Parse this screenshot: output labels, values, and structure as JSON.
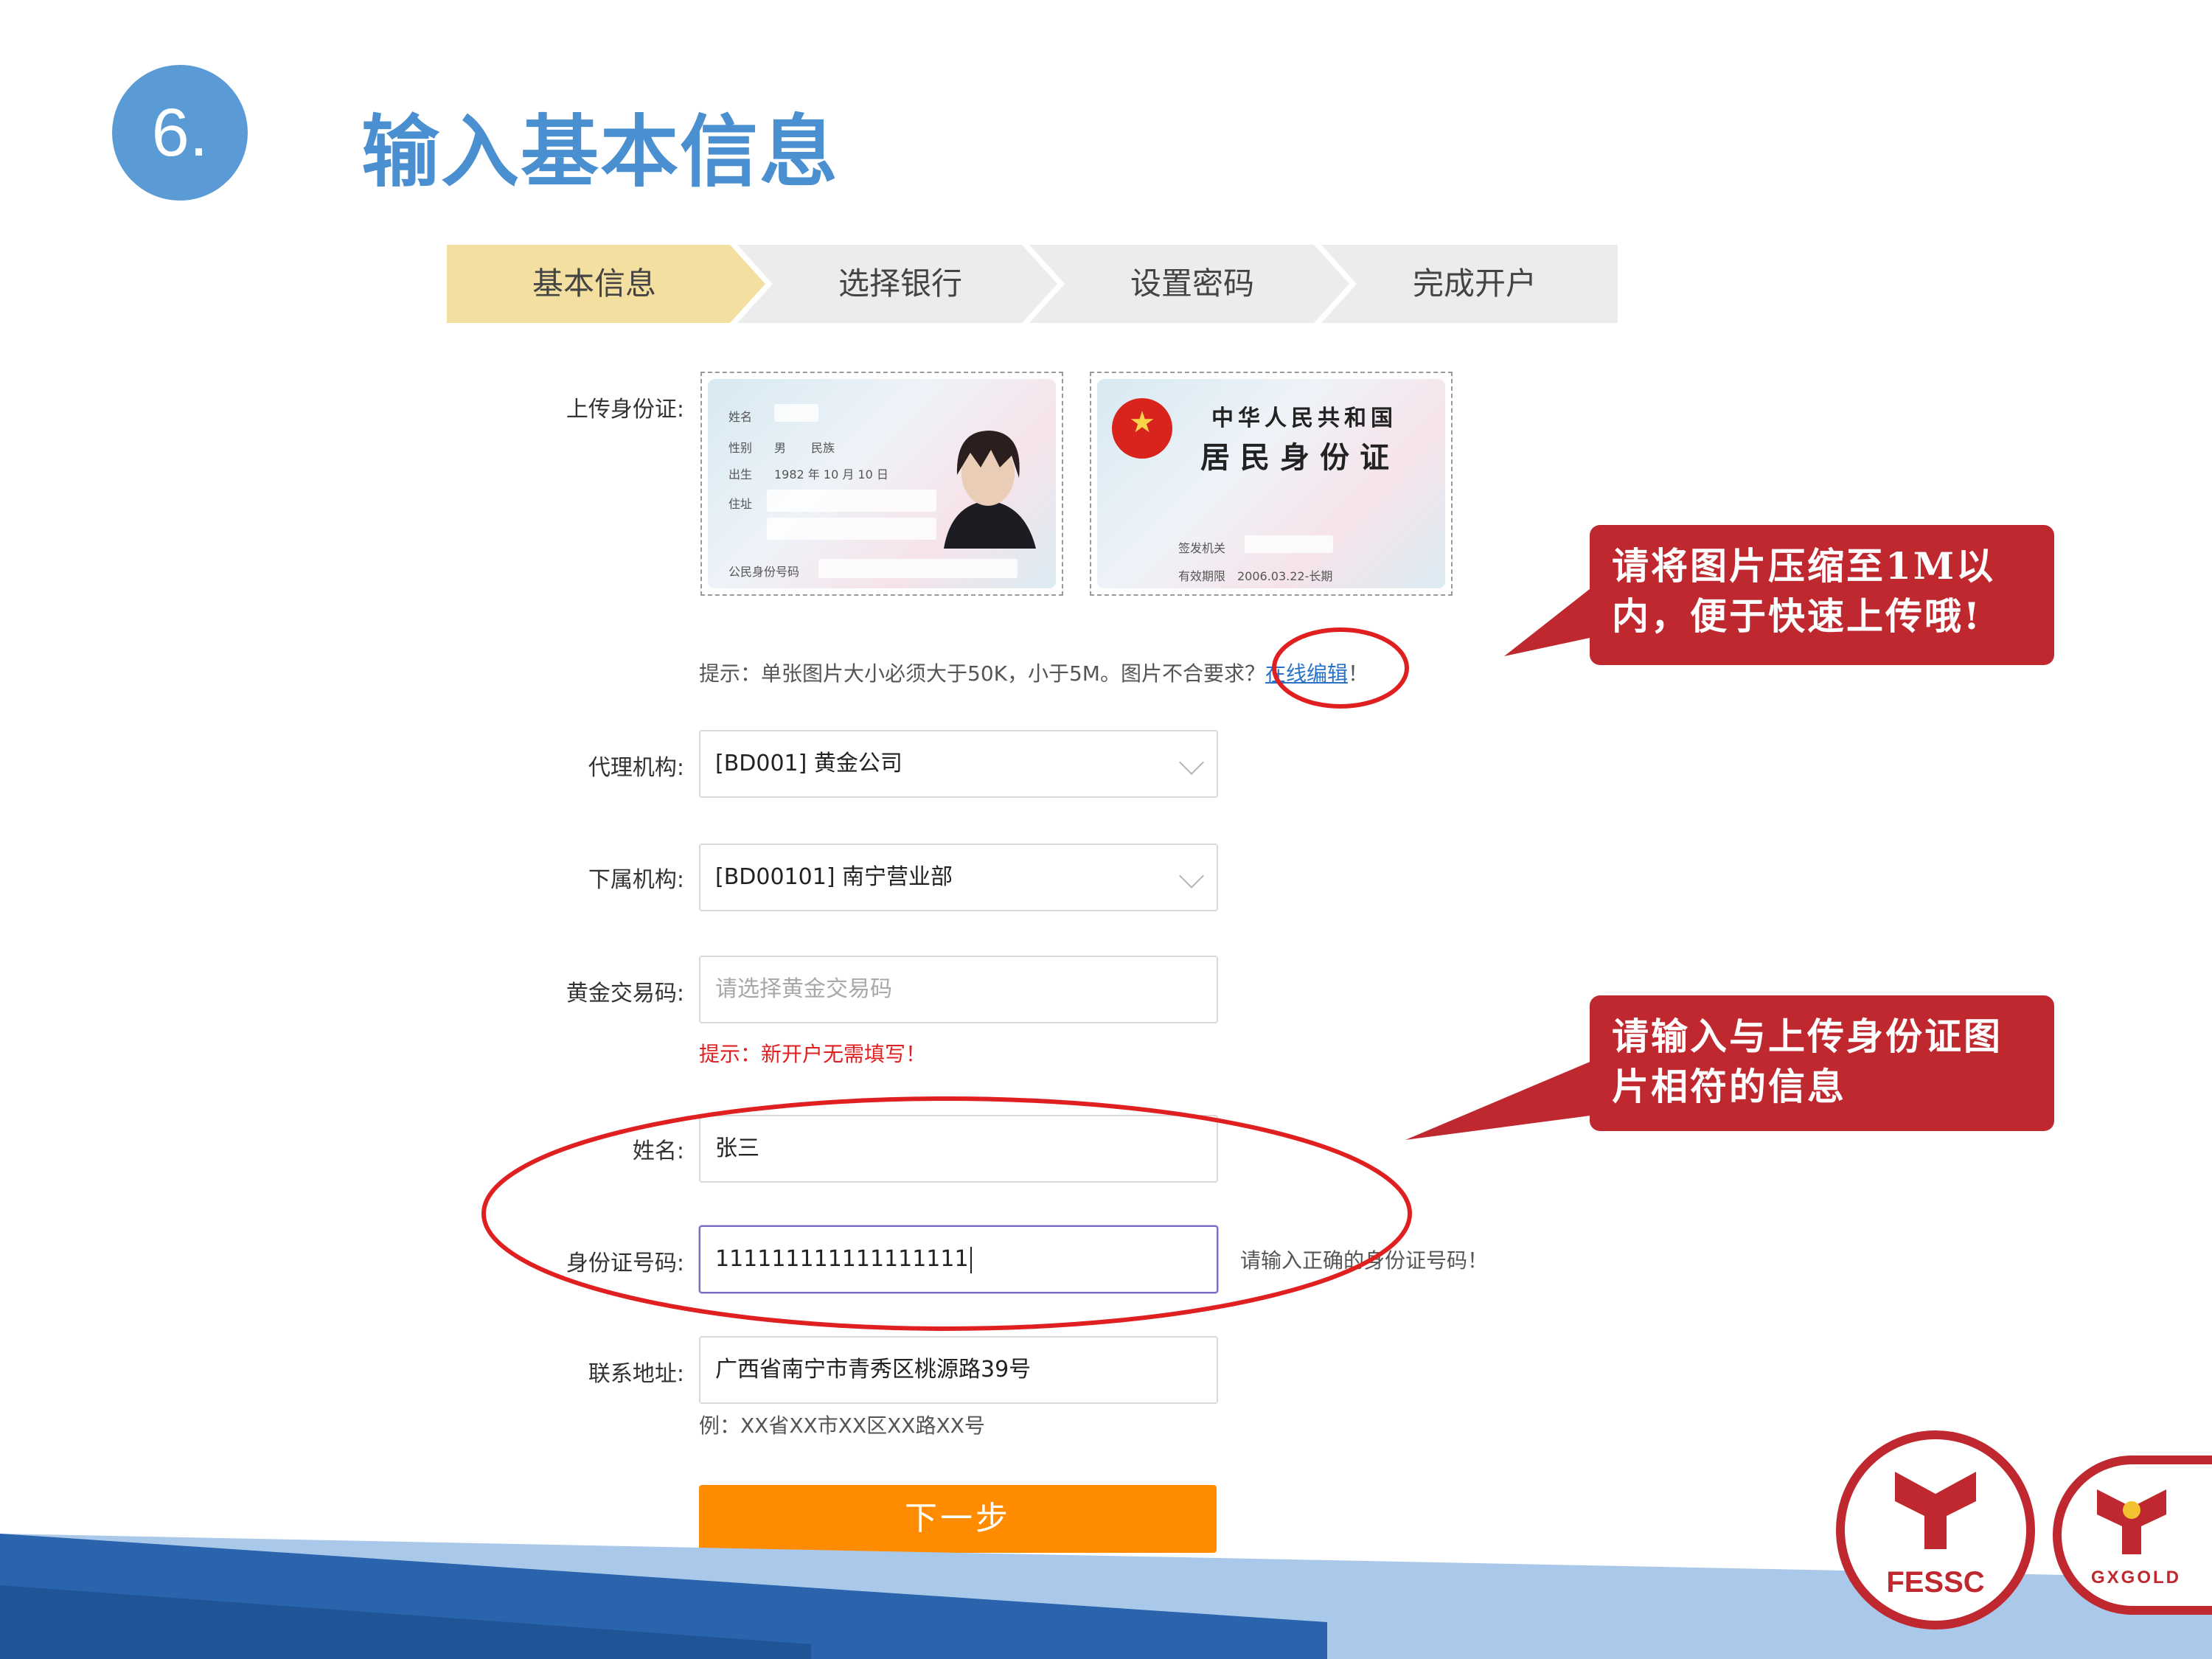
{
  "slide": {
    "step_number": "6.",
    "title": "输入基本信息",
    "accent_color": "#4a8fd0"
  },
  "stepper": {
    "steps": [
      {
        "label": "基本信息",
        "active": true
      },
      {
        "label": "选择银行",
        "active": false
      },
      {
        "label": "设置密码",
        "active": false
      },
      {
        "label": "完成开户",
        "active": false
      }
    ],
    "active_color": "#f3dfa0",
    "inactive_color": "#ececec"
  },
  "upload": {
    "label": "上传身份证:",
    "front_card": {
      "field_name": "姓名",
      "field_gender": "性别",
      "gender_value": "男",
      "field_ethnicity": "民族",
      "field_birth": "出生",
      "birth_value": "1982 年 10 月 10 日",
      "field_address": "住址",
      "field_id_number": "公民身份号码"
    },
    "back_card": {
      "title_country": "中华人民共和国",
      "title_card": "居民身份证",
      "field_authority": "签发机关",
      "field_validity": "有效期限",
      "validity_value": "2006.03.22-长期"
    },
    "hint_prefix": "提示：单张图片大小必须大于50K，小于5M。图片不合要求？",
    "hint_link": "在线编辑",
    "hint_suffix": "！"
  },
  "form": {
    "agency": {
      "label": "代理机构:",
      "value": "[BD001] 黄金公司"
    },
    "sub_agency": {
      "label": "下属机构:",
      "value": "[BD00101] 南宁营业部"
    },
    "gold_code": {
      "label": "黄金交易码:",
      "placeholder": "请选择黄金交易码",
      "hint": "提示：新开户无需填写！"
    },
    "name": {
      "label": "姓名:",
      "value": "张三"
    },
    "id_number": {
      "label": "身份证号码:",
      "value": "111111111111111111",
      "error": "请输入正确的身份证号码！"
    },
    "address": {
      "label": "联系地址:",
      "value": "广西省南宁市青秀区桃源路39号",
      "hint": "例：XX省XX市XX区XX路XX号"
    },
    "next_button": "下一步"
  },
  "callouts": {
    "upload_tip": "请将图片压缩至1M以内，便于快速上传哦!",
    "info_tip": "请输入与上传身份证图片相符的信息",
    "color": "#c0282f"
  },
  "logos": {
    "fessc": "FESSC",
    "gxgold": "GXGOLD"
  }
}
